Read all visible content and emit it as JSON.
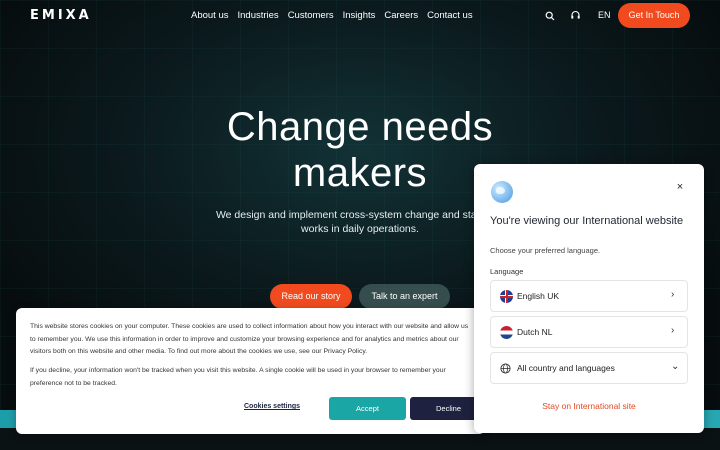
{
  "nav": {
    "logo": "EMIXA",
    "links": [
      "About us",
      "Industries",
      "Customers",
      "Insights",
      "Careers",
      "Contact us"
    ],
    "lang": "EN",
    "cta": "Get In Touch"
  },
  "hero": {
    "headline_line1": "Change needs",
    "headline_line2": "makers",
    "sub_line1": "We design and implement cross-system change and stay invo",
    "sub_line2": "works in daily operations.",
    "btn_story": "Read our story",
    "btn_expert": "Talk to an expert"
  },
  "cookie": {
    "text1": "This website stores cookies on your computer. These cookies are used to collect information about how you interact with our website and allow us to remember you. We use this information in order to improve and customize your browsing experience and for analytics and metrics about our visitors both on this website and other media. To find out more about the cookies we use, see our Privacy Policy.",
    "text2": "If you decline, your information won't be tracked when you visit this website. A single cookie will be used in your browser to remember your preference not to be tracked.",
    "settings": "Cookies settings",
    "accept": "Accept",
    "decline": "Decline"
  },
  "lang_modal": {
    "close": "×",
    "title": "You're viewing our International website",
    "subtitle": "Choose your preferred language.",
    "label": "Language",
    "options": [
      {
        "label": "English UK",
        "chevron": "›"
      },
      {
        "label": "Dutch NL",
        "chevron": "›"
      },
      {
        "label": "All country and languages",
        "chevron": "⌄"
      }
    ],
    "stay": "Stay on International site"
  },
  "colors": {
    "accent": "#f04a1e",
    "accept": "#1aa6a4",
    "decline": "#1f2140",
    "bg": "#0a1416"
  }
}
